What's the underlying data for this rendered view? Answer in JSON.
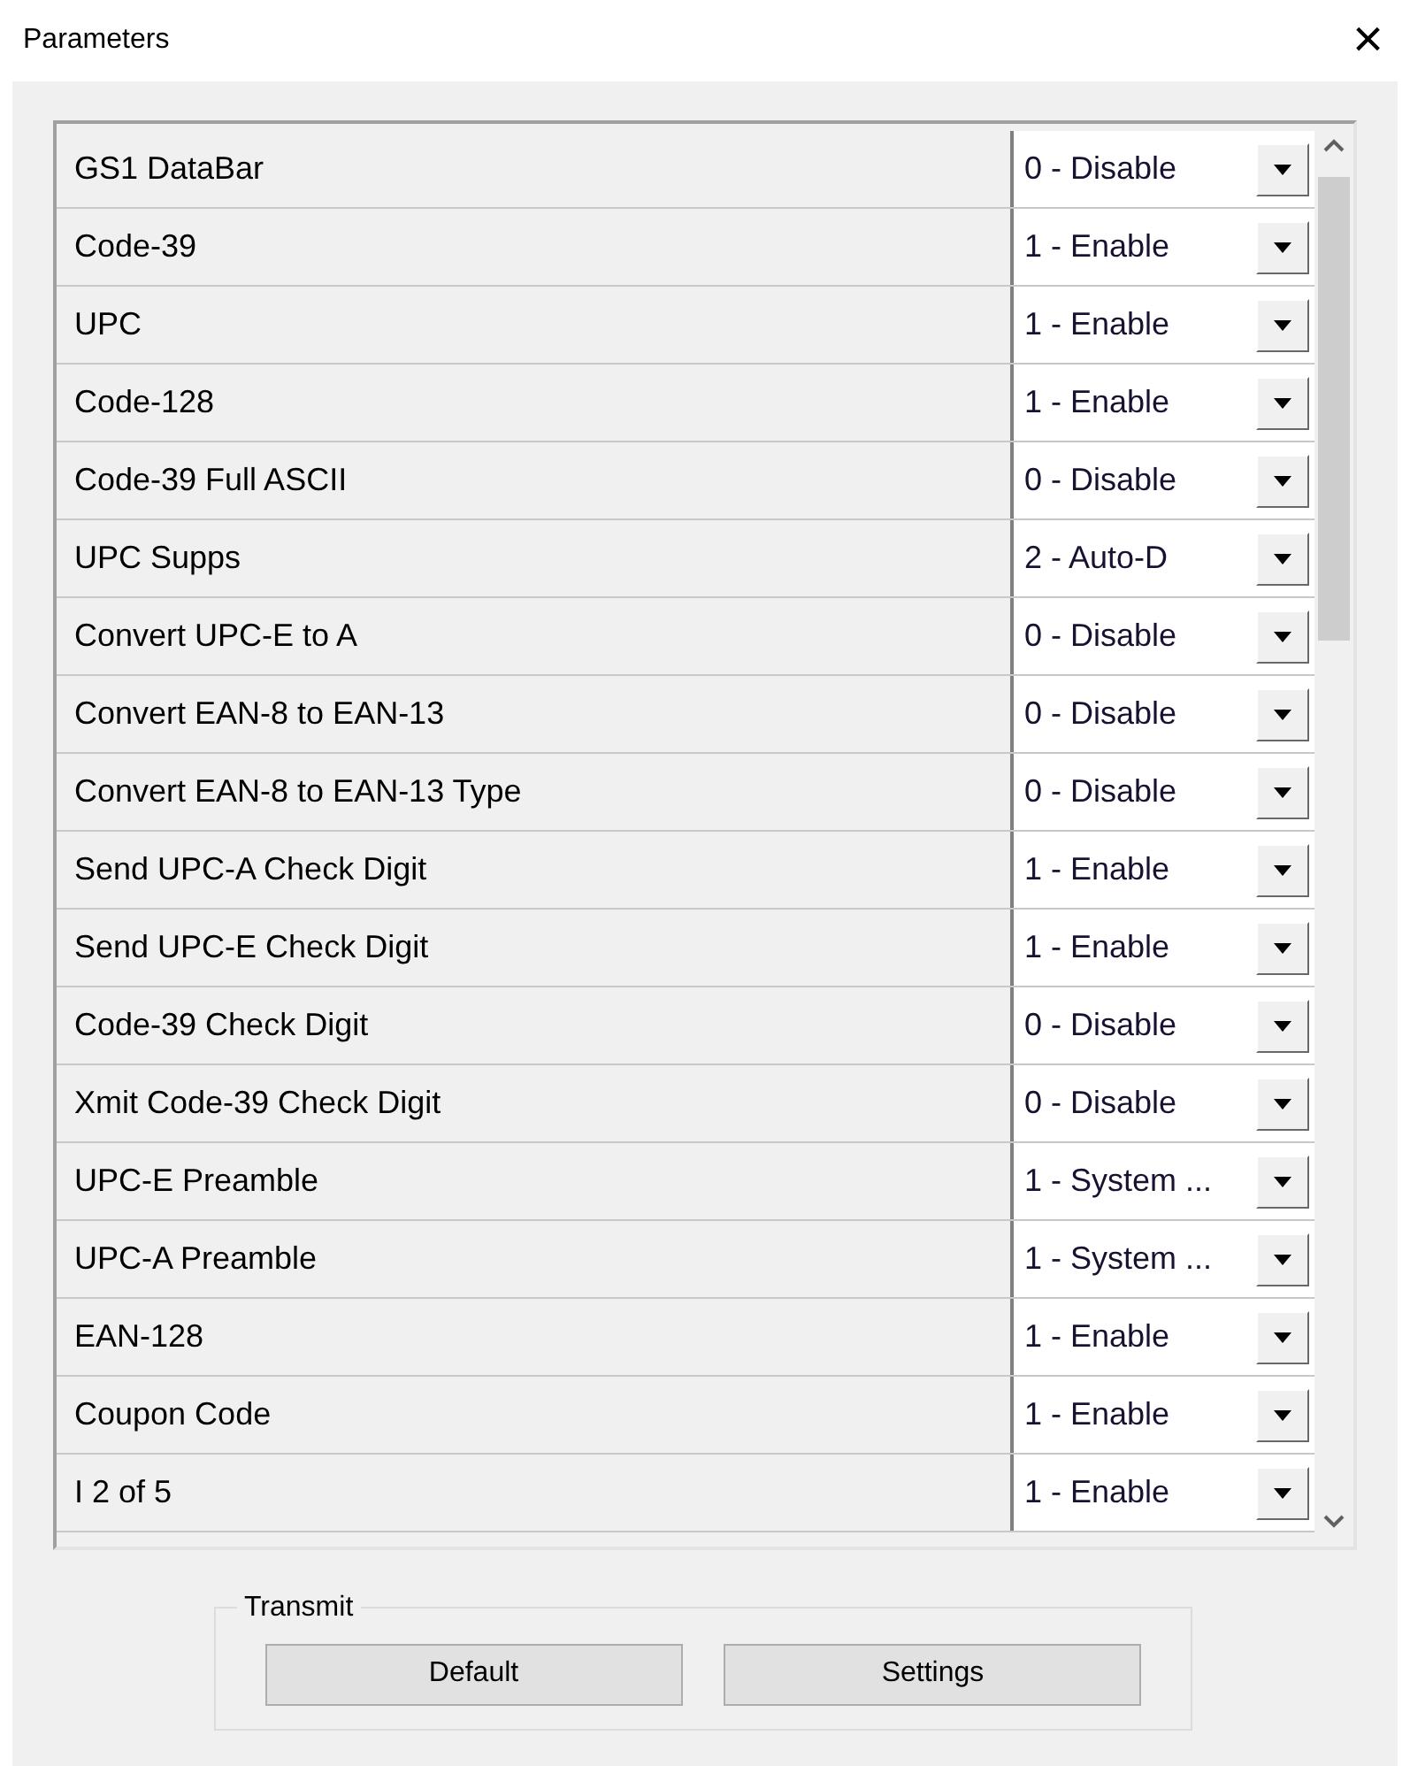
{
  "window": {
    "title": "Parameters",
    "close": "×"
  },
  "parameters": [
    {
      "name": "GS1 DataBar",
      "value": "0 - Disable"
    },
    {
      "name": "Code-39",
      "value": "1 - Enable"
    },
    {
      "name": "UPC",
      "value": "1 - Enable"
    },
    {
      "name": "Code-128",
      "value": "1 - Enable"
    },
    {
      "name": "Code-39 Full ASCII",
      "value": "0 - Disable"
    },
    {
      "name": "UPC Supps",
      "value": "2 - Auto-D"
    },
    {
      "name": "Convert UPC-E to A",
      "value": "0 - Disable"
    },
    {
      "name": "Convert EAN-8 to EAN-13",
      "value": "0 - Disable"
    },
    {
      "name": "Convert EAN-8 to EAN-13 Type",
      "value": "0 - Disable"
    },
    {
      "name": "Send UPC-A Check Digit",
      "value": "1 - Enable"
    },
    {
      "name": "Send UPC-E Check Digit",
      "value": "1 - Enable"
    },
    {
      "name": "Code-39 Check Digit",
      "value": "0 - Disable"
    },
    {
      "name": "Xmit Code-39 Check Digit",
      "value": "0 - Disable"
    },
    {
      "name": "UPC-E Preamble",
      "value": "1 - System ..."
    },
    {
      "name": "UPC-A Preamble",
      "value": "1 - System ..."
    },
    {
      "name": "EAN-128",
      "value": "1 - Enable"
    },
    {
      "name": "Coupon Code",
      "value": "1 - Enable"
    },
    {
      "name": "I 2 of 5",
      "value": "1 - Enable"
    }
  ],
  "transmit": {
    "label": "Transmit",
    "buttons": [
      "Default",
      "Settings"
    ]
  }
}
